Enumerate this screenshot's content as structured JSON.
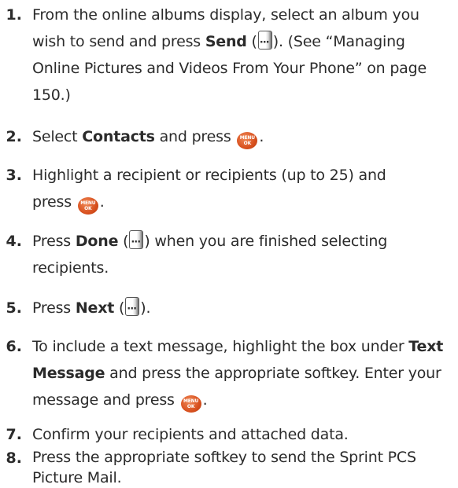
{
  "steps": [
    {
      "number": "1.",
      "parts": [
        "From the online albums display, select an album you wish to send and press ",
        "Send",
        " (",
        ").",
        " (See “Managing Online Pictures and Videos From Your Phone” on page 150.)"
      ]
    },
    {
      "number": "2.",
      "parts": [
        "Select ",
        "Contacts",
        " and press ",
        "."
      ]
    },
    {
      "number": "3.",
      "parts": [
        "Highlight a recipient or recipients (up to 25) and press ",
        "."
      ]
    },
    {
      "number": "4.",
      "parts": [
        "Press ",
        "Done",
        " (",
        ") when you are finished selecting recipients."
      ]
    },
    {
      "number": "5.",
      "parts": [
        "Press ",
        "Next",
        " (",
        ")."
      ]
    },
    {
      "number": "6.",
      "parts": [
        "To include a text message, highlight the box under ",
        "Text Message",
        " and press the appropriate softkey. Enter your message and press ",
        "."
      ]
    },
    {
      "number": "7.",
      "parts": [
        "Confirm your recipients and attached data."
      ]
    },
    {
      "number": "8.",
      "parts": [
        "Press the appropriate softkey to send the Sprint PCS Picture Mail."
      ]
    }
  ],
  "menu_key": {
    "top": "MENU",
    "bottom": "OK"
  },
  "colors": {
    "text": "#2b2b2b",
    "menu_key": "#d8501e"
  },
  "icons": {
    "softkey": "softkey-icon",
    "menu_ok": "menu-ok-key-icon"
  }
}
